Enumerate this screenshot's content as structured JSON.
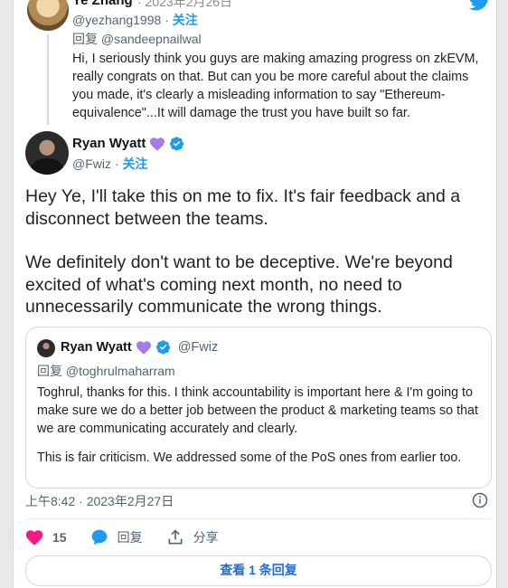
{
  "colors": {
    "accent": "#1d9bf0",
    "heart": "#f91880",
    "purple_heart": "#a47ce3",
    "text": "#0f1419",
    "muted": "#536471"
  },
  "parent_tweet": {
    "name": "Ye Zhang",
    "date": "· 2023年2月26日",
    "handle": "@yezhang1998",
    "follow_label": "关注",
    "reply_to": "回复 @sandeepnailwal",
    "text": "Hi, I seriously think you guys are making amazing progress on zkEVM, really congrats on that. But can you be more careful about the claims you made, it's clearly a misleading information to say \"Ethereum-equivalence\"...It will damage the trust you have built so far."
  },
  "tweet": {
    "name": "Ryan Wyatt",
    "handle": "@Fwiz",
    "follow_label": "关注",
    "paragraphs": [
      "Hey Ye, I'll take this on me to fix. It's fair feedback and a disconnect between the teams.",
      "We definitely don't want to be deceptive. We're beyond excited of what's coming next month, no need to unnecessarily communicate the wrong things."
    ],
    "timestamp": "上午8:42 · 2023年2月27日"
  },
  "quote": {
    "name": "Ryan Wyatt",
    "handle": "@Fwiz",
    "reply_to": "回复 @toghrulmaharram",
    "paragraphs": [
      "Toghrul, thanks for this. I think accountability is important here & I'm going to make sure we do a better job between the product & marketing teams so that we are communicating accurately and clearly.",
      "This is fair criticism. We addressed some of the PoS ones from earlier too."
    ]
  },
  "actions": {
    "like_count": "15",
    "reply_label": "回复",
    "share_label": "分享"
  },
  "more_replies_label": "查看 1 条回复",
  "icons": [
    "twitter-bird-icon",
    "verified-badge-icon",
    "purple-heart-icon",
    "info-icon",
    "heart-icon",
    "reply-bubble-icon",
    "share-icon"
  ]
}
